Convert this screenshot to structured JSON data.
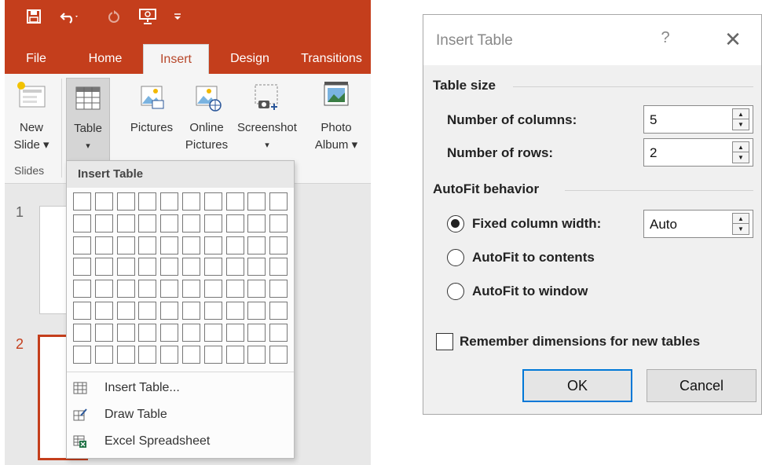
{
  "quick_access": {
    "save_icon": "save-icon",
    "undo_icon": "undo-icon",
    "redo_icon": "redo-icon",
    "slideshow_icon": "slideshow-from-beginning-icon",
    "customize_icon": "customize-toolbar-icon"
  },
  "tabs": [
    {
      "label": "File"
    },
    {
      "label": "Home"
    },
    {
      "label": "Insert"
    },
    {
      "label": "Design"
    },
    {
      "label": "Transitions"
    }
  ],
  "ribbon": {
    "new_slide": {
      "line1": "New",
      "line2": "Slide ▾"
    },
    "table": {
      "line1": "Table",
      "line2": "▾"
    },
    "pictures": {
      "line1": "Pictures"
    },
    "online_pictures": {
      "line1": "Online",
      "line2": "Pictures"
    },
    "screenshot": {
      "line1": "Screenshot",
      "line2": "▾"
    },
    "photo_album": {
      "line1": "Photo",
      "line2": "Album ▾"
    },
    "group_slides": "Slides"
  },
  "slides": [
    {
      "number": "1"
    },
    {
      "number": "2"
    }
  ],
  "dropdown": {
    "header": "Insert Table",
    "grid_columns": 10,
    "grid_rows": 8,
    "items": [
      {
        "label": "Insert Table...",
        "icon": "insert-table-icon"
      },
      {
        "label": "Draw Table",
        "icon": "draw-table-icon"
      },
      {
        "label": "Excel Spreadsheet",
        "icon": "excel-spreadsheet-icon"
      }
    ]
  },
  "dialog": {
    "title": "Insert Table",
    "help": "?",
    "close": "✕",
    "table_size": {
      "heading": "Table size",
      "columns_label": "Number of columns:",
      "columns_value": "5",
      "rows_label": "Number of rows:",
      "rows_value": "2"
    },
    "autofit": {
      "heading": "AutoFit behavior",
      "fixed_label": "Fixed column width:",
      "fixed_value": "Auto",
      "contents_label": "AutoFit to contents",
      "window_label": "AutoFit to window",
      "selected": "fixed"
    },
    "remember_label": "Remember dimensions for new tables",
    "remember_checked": false,
    "ok_label": "OK",
    "cancel_label": "Cancel"
  },
  "colors": {
    "accent": "#c43e1c",
    "default_button_border": "#0078d7"
  }
}
